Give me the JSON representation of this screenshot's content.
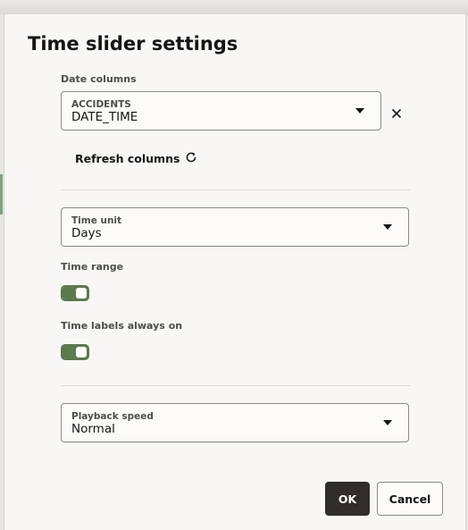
{
  "dialog": {
    "title": "Time slider settings"
  },
  "date_columns": {
    "label": "Date columns",
    "table": "ACCIDENTS",
    "value": "DATE_TIME",
    "clear_icon": "close-icon"
  },
  "refresh": {
    "label": "Refresh columns",
    "icon": "refresh-icon"
  },
  "time_unit": {
    "label": "Time unit",
    "value": "Days"
  },
  "time_range": {
    "label": "Time range",
    "enabled": true
  },
  "time_labels": {
    "label": "Time labels always on",
    "enabled": true
  },
  "playback_speed": {
    "label": "Playback speed",
    "value": "Normal"
  },
  "buttons": {
    "ok": "OK",
    "cancel": "Cancel"
  },
  "colors": {
    "toggle_on": "#5b7b4c",
    "primary_button": "#312d2a",
    "dialog_background": "#f8f7f5"
  }
}
